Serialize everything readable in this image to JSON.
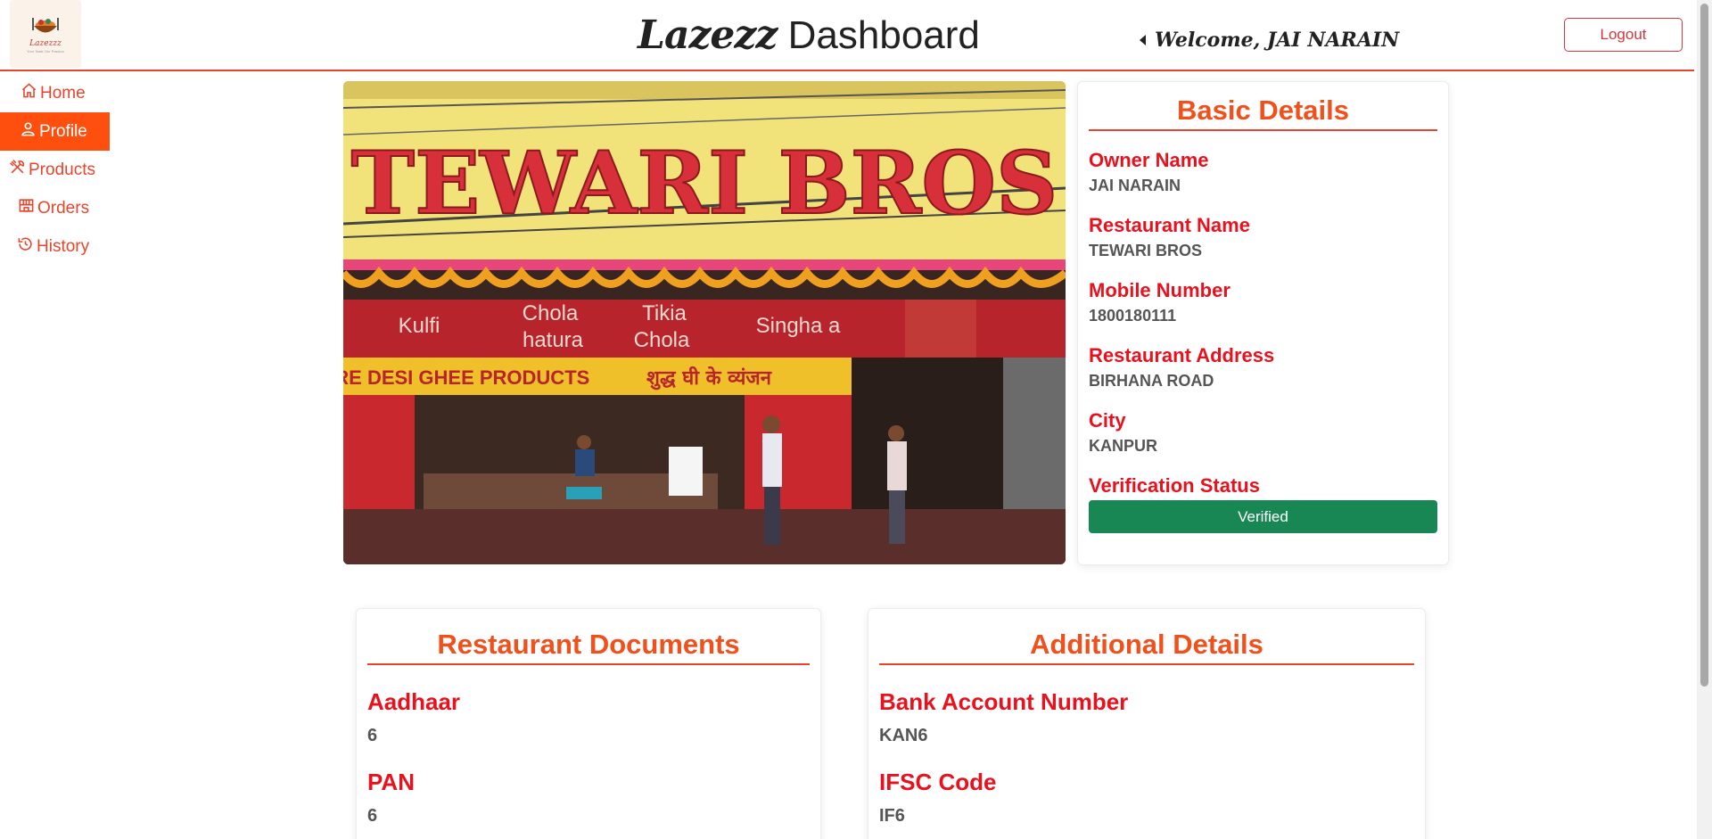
{
  "header": {
    "logo_text": "Lazezzz",
    "logo_tagline": "Your Taste Our Passion",
    "title_brand": "Lazezz",
    "title_rest": " Dashboard",
    "welcome": "Welcome, JAI NARAIN",
    "logout_label": "Logout"
  },
  "sidebar": {
    "items": [
      {
        "label": "Home",
        "icon": "home-icon",
        "active": false
      },
      {
        "label": "Profile",
        "icon": "user-icon",
        "active": true
      },
      {
        "label": "Products",
        "icon": "utensils-icon",
        "active": false
      },
      {
        "label": "Orders",
        "icon": "shop-icon",
        "active": false
      },
      {
        "label": "History",
        "icon": "history-icon",
        "active": false
      }
    ]
  },
  "hero": {
    "sign_text": "TEWARI BROS",
    "menu_words": [
      "Kulfi",
      "Chola",
      "hatura",
      "Tikia",
      "Chola",
      "Singha a"
    ],
    "banner_text": "PURE DESI GHEE PRODUCTS",
    "banner_hindi": "शुद्ध घी के व्यंजन"
  },
  "basic_details": {
    "title": "Basic Details",
    "fields": [
      {
        "label": "Owner Name",
        "value": "JAI NARAIN"
      },
      {
        "label": "Restaurant Name",
        "value": "TEWARI BROS"
      },
      {
        "label": "Mobile Number",
        "value": "1800180111"
      },
      {
        "label": "Restaurant Address",
        "value": "BIRHANA ROAD"
      },
      {
        "label": "City",
        "value": "KANPUR"
      }
    ],
    "verification_label": "Verification Status",
    "verification_value": "Verified"
  },
  "documents": {
    "title": "Restaurant Documents",
    "fields": [
      {
        "label": "Aadhaar",
        "value": "6"
      },
      {
        "label": "PAN",
        "value": "6"
      }
    ]
  },
  "additional": {
    "title": "Additional Details",
    "fields": [
      {
        "label": "Bank Account Number",
        "value": "KAN6"
      },
      {
        "label": "IFSC Code",
        "value": "IF6"
      }
    ]
  },
  "colors": {
    "accent": "#e8452c",
    "active_nav": "#ff4f0f",
    "label_red": "#e8121f",
    "verified_green": "#198754"
  }
}
